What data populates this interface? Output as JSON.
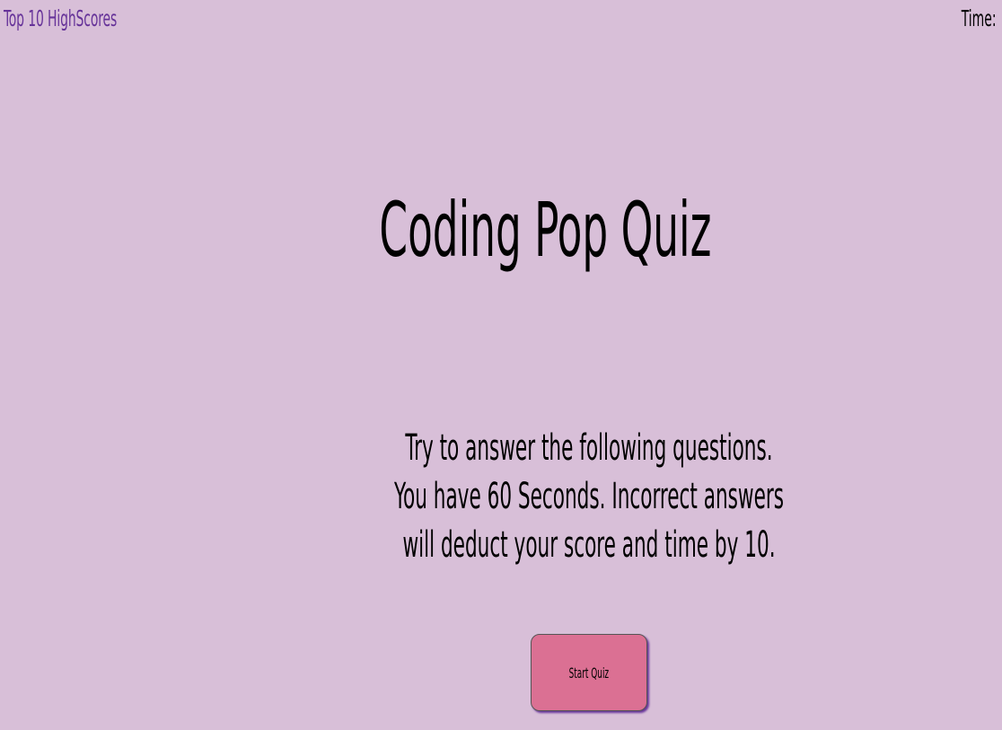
{
  "header": {
    "highscores_link": "Top 10 HighScores",
    "timer_label": "Time:"
  },
  "main": {
    "title": "Coding Pop Quiz",
    "instructions": [
      "Try to answer the following questions.",
      "You have 60 Seconds. Incorrect answers",
      "will deduct your score and time by 10."
    ],
    "start_button_label": "Start Quiz"
  },
  "colors": {
    "background": "#d8bfd8",
    "link": "#663399",
    "button": "#db7093"
  }
}
